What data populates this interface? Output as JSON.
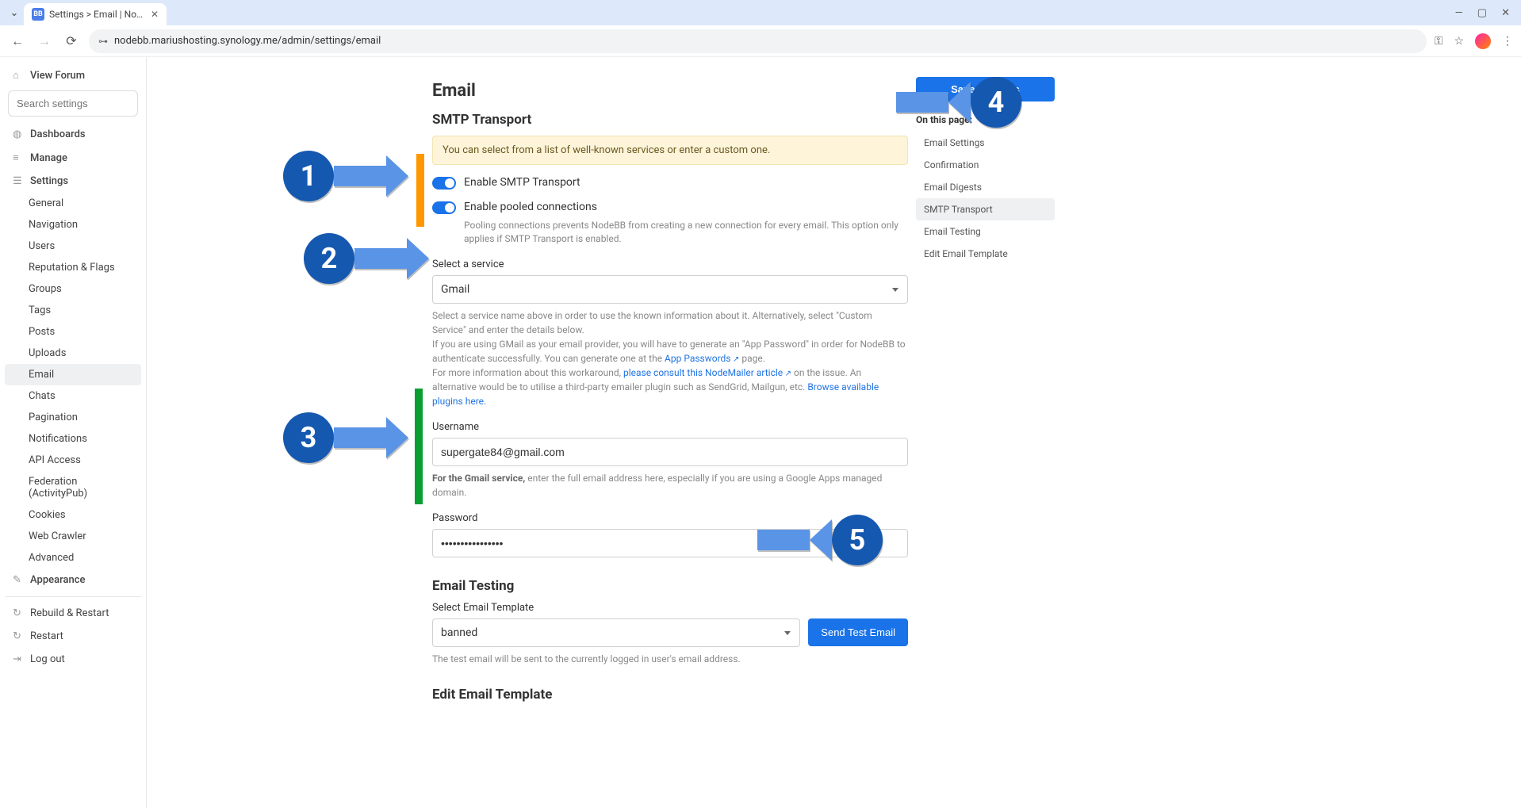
{
  "browser": {
    "tab_title": "Settings > Email | NodeB…",
    "favicon_text": "BB",
    "url": "nodebb.mariushosting.synology.me/admin/settings/email"
  },
  "sidebar": {
    "view_forum": "View Forum",
    "search_placeholder": "Search settings",
    "dashboards": "Dashboards",
    "manage": "Manage",
    "settings": "Settings",
    "settings_items": [
      "General",
      "Navigation",
      "Users",
      "Reputation & Flags",
      "Groups",
      "Tags",
      "Posts",
      "Uploads",
      "Email",
      "Chats",
      "Pagination",
      "Notifications",
      "API Access",
      "Federation (ActivityPub)",
      "Cookies",
      "Web Crawler",
      "Advanced"
    ],
    "appearance": "Appearance",
    "rebuild": "Rebuild & Restart",
    "restart": "Restart",
    "logout": "Log out"
  },
  "page": {
    "title": "Email",
    "smtp_heading": "SMTP Transport",
    "alert": "You can select from a list of well-known services or enter a custom one.",
    "toggle1_label": "Enable SMTP Transport",
    "toggle2_label": "Enable pooled connections",
    "toggle2_help": "Pooling connections prevents NodeBB from creating a new connection for every email. This option only applies if SMTP Transport is enabled.",
    "service_label": "Select a service",
    "service_value": "Gmail",
    "service_help1": "Select a service name above in order to use the known information about it. Alternatively, select \"Custom Service\" and enter the details below.",
    "service_help2a": "If you are using GMail as your email provider, you will have to generate an \"App Password\" in order for NodeBB to authenticate successfully. You can generate one at the ",
    "service_help2_link": "App Passwords",
    "service_help2b": " page.",
    "service_help3a": "For more information about this workaround, ",
    "service_help3_link": "please consult this NodeMailer article",
    "service_help3b": " on the issue. An alternative would be to utilise a third-party emailer plugin such as SendGrid, Mailgun, etc. ",
    "service_help3_link2": "Browse available plugins here.",
    "username_label": "Username",
    "username_value": "supergate84@gmail.com",
    "username_help_bold": "For the Gmail service,",
    "username_help_rest": " enter the full email address here, especially if you are using a Google Apps managed domain.",
    "password_label": "Password",
    "password_value": "••••••••••••••••",
    "testing_heading": "Email Testing",
    "template_label": "Select Email Template",
    "template_value": "banned",
    "send_test": "Send Test Email",
    "testing_help": "The test email will be sent to the currently logged in user's email address.",
    "edit_heading": "Edit Email Template"
  },
  "right": {
    "save": "Save changes",
    "on_this_page": "On this page:",
    "links": [
      "Email Settings",
      "Confirmation",
      "Email Digests",
      "SMTP Transport",
      "Email Testing",
      "Edit Email Template"
    ]
  },
  "annotations": {
    "n1": "1",
    "n2": "2",
    "n3": "3",
    "n4": "4",
    "n5": "5"
  }
}
